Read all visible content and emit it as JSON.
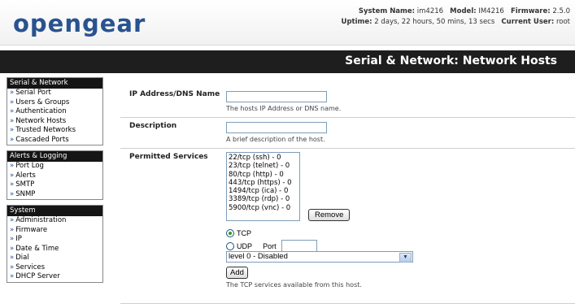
{
  "header": {
    "logo": "opengear",
    "sysinfo": {
      "system_name_label": "System Name:",
      "system_name": "im4216",
      "model_label": "Model:",
      "model": "IM4216",
      "firmware_label": "Firmware:",
      "firmware": "2.5.0",
      "uptime_label": "Uptime:",
      "uptime": "2 days, 22 hours, 50 mins, 13 secs",
      "user_label": "Current User:",
      "user": "root"
    }
  },
  "page_title": "Serial & Network: Network Hosts",
  "sidebar": {
    "sections": [
      {
        "title": "Serial & Network",
        "items": [
          "Serial Port",
          "Users & Groups",
          "Authentication",
          "Network Hosts",
          "Trusted Networks",
          "Cascaded Ports"
        ]
      },
      {
        "title": "Alerts & Logging",
        "items": [
          "Port Log",
          "Alerts",
          "SMTP",
          "SNMP"
        ]
      },
      {
        "title": "System",
        "items": [
          "Administration",
          "Firmware",
          "IP",
          "Date & Time",
          "Dial",
          "Services",
          "DHCP Server"
        ]
      }
    ],
    "arrow": "»"
  },
  "form": {
    "ip": {
      "label": "IP Address/DNS Name",
      "value": "",
      "hint": "The hosts IP Address or DNS name."
    },
    "description": {
      "label": "Description",
      "value": "",
      "hint": "A brief description of the host."
    },
    "services": {
      "label": "Permitted Services",
      "options": [
        "22/tcp (ssh) - 0",
        "23/tcp (telnet) - 0",
        "80/tcp (http) - 0",
        "443/tcp (https) - 0",
        "1494/tcp (ica) - 0",
        "3389/tcp (rdp) - 0",
        "5900/tcp (vnc) - 0"
      ],
      "remove_label": "Remove",
      "tcp_label": "TCP",
      "udp_label": "UDP",
      "port_label": "Port",
      "port_value": "",
      "level_value": "level 0 - Disabled",
      "add_label": "Add",
      "hint": "The TCP services available from this host."
    }
  }
}
